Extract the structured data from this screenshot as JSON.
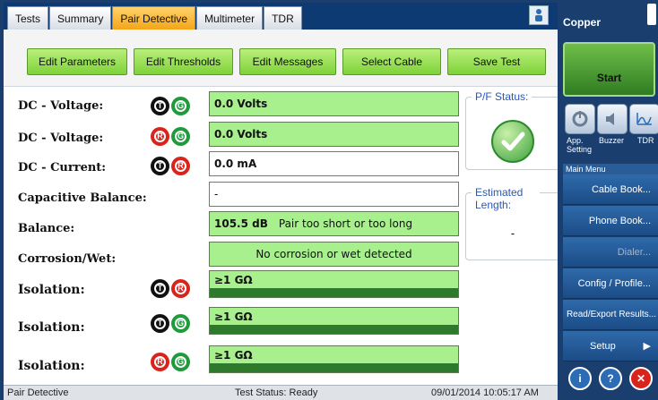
{
  "tabs": [
    {
      "label": "Tests"
    },
    {
      "label": "Summary"
    },
    {
      "label": "Pair Detective",
      "active": true
    },
    {
      "label": "Multimeter"
    },
    {
      "label": "TDR"
    }
  ],
  "toolbar": {
    "edit_parameters": "Edit Parameters",
    "edit_thresholds": "Edit Thresholds",
    "edit_messages": "Edit Messages",
    "select_cable": "Select Cable",
    "save_test": "Save Test"
  },
  "rows": {
    "dc_voltage_tg": {
      "label": "DC - Voltage:",
      "badges": [
        "T",
        "G"
      ],
      "value": "0.0 Volts"
    },
    "dc_voltage_rg": {
      "label": "DC - Voltage:",
      "badges": [
        "R",
        "G"
      ],
      "value": "0.0 Volts"
    },
    "dc_current": {
      "label": "DC - Current:",
      "badges": [
        "T",
        "R"
      ],
      "value": "0.0 mA"
    },
    "capacitive_balance": {
      "label": "Capacitive Balance:",
      "value": "-"
    },
    "balance": {
      "label": "Balance:",
      "value": "105.5 dB",
      "note": "Pair too short or too long"
    },
    "corrosion": {
      "label": "Corrosion/Wet:",
      "value": "No corrosion or wet detected"
    },
    "isolation_tr": {
      "label": "Isolation:",
      "badges": [
        "T",
        "R"
      ],
      "value": "≥1 GΩ"
    },
    "isolation_tg": {
      "label": "Isolation:",
      "badges": [
        "T",
        "G"
      ],
      "value": "≥1 GΩ"
    },
    "isolation_rg": {
      "label": "Isolation:",
      "badges": [
        "R",
        "G"
      ],
      "value": "≥1 GΩ"
    }
  },
  "pf_status": {
    "title": "P/F Status:"
  },
  "estimated_length": {
    "title": "Estimated Length:",
    "value": "-"
  },
  "status_bar": {
    "left": "Pair Detective",
    "center": "Test Status: Ready",
    "right": "09/01/2014 10:05:17 AM"
  },
  "sidebar": {
    "title": "Copper",
    "start_label": "Start",
    "quick": [
      {
        "label": "App. Setting",
        "icon": "wrench-icon"
      },
      {
        "label": "Buzzer",
        "icon": "speaker-icon"
      },
      {
        "label": "TDR",
        "icon": "tdr-graph-icon"
      }
    ],
    "menu_title": "Main Menu",
    "menu": [
      {
        "label": "Cable Book..."
      },
      {
        "label": "Phone Book..."
      },
      {
        "label": "Dialer..."
      },
      {
        "label": "Config / Profile..."
      },
      {
        "label": "Read/Export Results..."
      },
      {
        "label": "Setup"
      }
    ]
  },
  "colors": {
    "pass_green": "#a8f08e",
    "accent_blue": "#1a3f6e",
    "tab_active": "#f3a51a"
  }
}
